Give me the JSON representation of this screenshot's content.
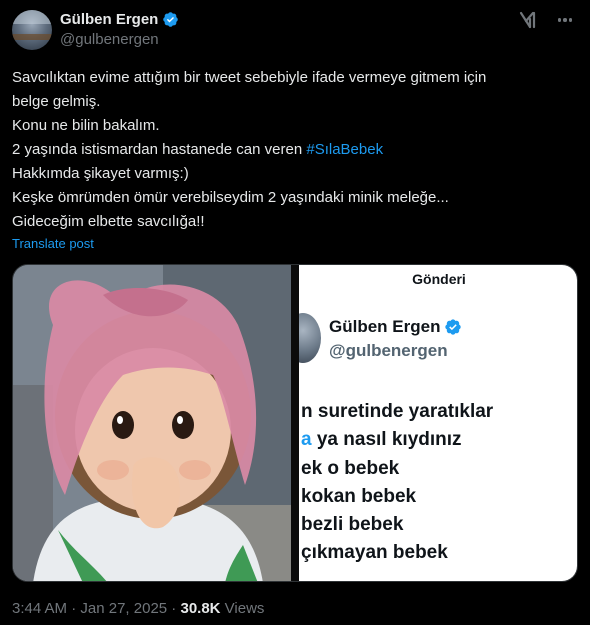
{
  "author": {
    "display_name": "Gülben Ergen",
    "handle": "@gulbenergen",
    "verified": true
  },
  "tweet": {
    "lines": [
      "Savcılıktan evime attığım bir tweet sebebiyle ifade vermeye gitmem için",
      "belge gelmiş.",
      "Konu ne bilin bakalım."
    ],
    "line4_prefix": "2 yaşında istismardan hastanede can veren ",
    "hashtag": "#SılaBebek",
    "lines_after": [
      "Hakkımda şikayet varmış:)",
      "Keşke ömrümden ömür verebilseydim 2 yaşındaki minik meleğe...",
      "Gideceğim elbette savcılığa!!"
    ],
    "translate_label": "Translate post"
  },
  "media": {
    "screenshot": {
      "title": "Gönderi",
      "display_name": "Gülben Ergen",
      "handle": "@gulbenergen",
      "line1": "n suretinde yaratıklar",
      "line2_blue": "a",
      "line2_rest": " ya nasıl kıydınız",
      "line3": "ek o bebek",
      "line4": "kokan bebek",
      "line5": "bezli bebek",
      "line6": "çıkmayan bebek"
    }
  },
  "meta": {
    "time": "3:44 AM",
    "separator": " · ",
    "date": "Jan 27, 2025",
    "views_count": "30.8K",
    "views_label": " Views"
  },
  "colors": {
    "accent": "#1d9bf0",
    "text": "#e7e9ea",
    "muted": "#71767b",
    "background": "#000000"
  },
  "icons": [
    "verified-badge-icon",
    "grok-icon",
    "more-options-icon"
  ]
}
